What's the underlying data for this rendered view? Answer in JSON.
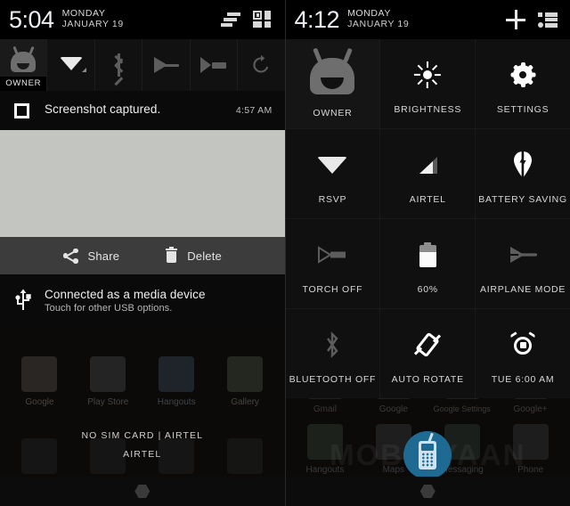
{
  "left_panel": {
    "statusbar": {
      "time": "5:04",
      "day": "MONDAY",
      "date": "JANUARY 19",
      "clear_all_icon": "clear-all-notifications-icon",
      "qs_grid_icon": "quick-settings-grid-icon"
    },
    "quick_strip": [
      {
        "name": "user",
        "label": "OWNER",
        "icon": "android-robot-avatar-icon"
      },
      {
        "name": "wifi",
        "label": "",
        "icon": "wifi-icon"
      },
      {
        "name": "bluetooth",
        "label": "",
        "icon": "bluetooth-icon"
      },
      {
        "name": "airplane",
        "label": "",
        "icon": "airplane-mode-icon"
      },
      {
        "name": "torch",
        "label": "",
        "icon": "torch-icon"
      },
      {
        "name": "rotate",
        "label": "",
        "icon": "auto-rotate-icon"
      }
    ],
    "notifications": [
      {
        "icon": "screenshot-icon",
        "title": "Screenshot captured.",
        "time": "4:57 AM"
      },
      {
        "icon": "usb-icon",
        "title": "Connected as a media device",
        "sub": "Touch for other USB options."
      }
    ],
    "actions": {
      "share_label": "Share",
      "share_icon": "share-icon",
      "delete_label": "Delete",
      "delete_icon": "trash-icon"
    },
    "home_apps": [
      {
        "label": "Google",
        "color": "#2a2623"
      },
      {
        "label": "Play Store",
        "color": "#232323"
      },
      {
        "label": "Hangouts",
        "color": "#1d2327"
      },
      {
        "label": "Gallery",
        "color": "#22261f"
      }
    ],
    "sim_line_1": "NO SIM CARD  |  AIRTEL",
    "sim_line_2": "AIRTEL",
    "navbar": {
      "home_icon": "home-hexagon-icon"
    }
  },
  "right_panel": {
    "statusbar": {
      "time": "4:12",
      "day": "MONDAY",
      "date": "JANUARY 19",
      "add_icon": "plus-add-tile-icon",
      "notif_list_icon": "notification-list-icon"
    },
    "tiles": [
      {
        "label": "OWNER",
        "icon": "android-robot-avatar-icon",
        "state": "user"
      },
      {
        "label": "BRIGHTNESS",
        "icon": "brightness-sun-icon",
        "state": "on"
      },
      {
        "label": "SETTINGS",
        "icon": "settings-gear-icon",
        "state": "on"
      },
      {
        "label": "RSVP",
        "icon": "wifi-icon",
        "state": "on"
      },
      {
        "label": "AIRTEL",
        "icon": "cellular-signal-icon",
        "state": "on"
      },
      {
        "label": "BATTERY SAVING",
        "icon": "battery-saving-pin-icon",
        "state": "on"
      },
      {
        "label": "TORCH OFF",
        "icon": "torch-icon",
        "state": "off"
      },
      {
        "label": "60%",
        "icon": "battery-icon",
        "state": "on"
      },
      {
        "label": "AIRPLANE MODE",
        "icon": "airplane-mode-icon",
        "state": "off"
      },
      {
        "label": "BLUETOOTH OFF",
        "icon": "bluetooth-icon",
        "state": "off"
      },
      {
        "label": "AUTO ROTATE",
        "icon": "auto-rotate-icon",
        "state": "on"
      },
      {
        "label": "TUE 6:00 AM",
        "icon": "alarm-clock-icon",
        "state": "on"
      }
    ],
    "battery_percent": 60,
    "home_apps_top": [
      {
        "label": "Gmail",
        "color": "#241f1f"
      },
      {
        "label": "Google",
        "color": "#20211f"
      },
      {
        "label": "Google Settings",
        "color": "#1f2022"
      },
      {
        "label": "Google+",
        "color": "#231f1f"
      }
    ],
    "home_apps_bottom": [
      {
        "label": "Hangouts",
        "color": "#1c211c"
      },
      {
        "label": "Maps",
        "color": "#1e1e1e"
      },
      {
        "label": "Messaging",
        "color": "#1b1f1c"
      },
      {
        "label": "Phone",
        "color": "#1d1d1d"
      }
    ],
    "watermark_text": "MOBIGYAAN",
    "watermark_logo": "mobigyaan-phone-logo",
    "navbar": {
      "home_icon": "home-hexagon-icon"
    }
  },
  "colors": {
    "shade_bg": "#0a0a0a",
    "tile_bg": "#101010",
    "preview_gray": "#c3c5c0",
    "action_bar": "#3c3c3c",
    "watermark_blue": "#1f6a93"
  }
}
